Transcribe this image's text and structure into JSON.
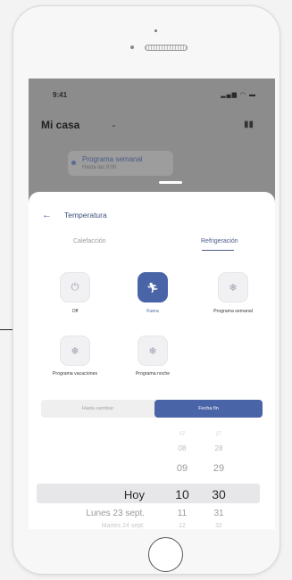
{
  "statusbar": {
    "time": "9:41",
    "icons": "signal-wifi-battery"
  },
  "home": {
    "title": "Mi casa",
    "chip_title": "Programa semanal",
    "chip_subtitle": "Hasta las 9:00"
  },
  "sheet": {
    "back_icon": "arrow-left-icon",
    "title": "Temperatura",
    "tabs": [
      {
        "label": "Calefacción",
        "active": false
      },
      {
        "label": "Refrigeración",
        "active": true
      }
    ],
    "modes": [
      {
        "label": "Off",
        "icon": "power-icon",
        "active": false
      },
      {
        "label": "Fuera",
        "icon": "walking-person-icon",
        "active": true
      },
      {
        "label": "Programa semanal",
        "icon": "snowflake-icon",
        "active": false
      },
      {
        "label": "Programa vacaciones",
        "icon": "snowflake-icon",
        "active": false
      },
      {
        "label": "Programa noche",
        "icon": "snowflake-icon",
        "active": false
      }
    ],
    "segment": {
      "left": "Hasta cambiar",
      "right": "Fecha fin",
      "selected": "right"
    },
    "picker": {
      "days": [
        "",
        "",
        "Hoy",
        "Lunes 23 sept.",
        "Martes 24 sept."
      ],
      "hours": [
        "07",
        "08",
        "09",
        "10",
        "11",
        "12"
      ],
      "minutes": [
        "27",
        "28",
        "29",
        "30",
        "31",
        "32"
      ],
      "selected": {
        "day": "Hoy",
        "hour": "10",
        "minute": "30"
      }
    }
  },
  "colors": {
    "accent": "#4a64a8",
    "backdrop": "#8c8c8c",
    "sheet": "#ffffff"
  }
}
